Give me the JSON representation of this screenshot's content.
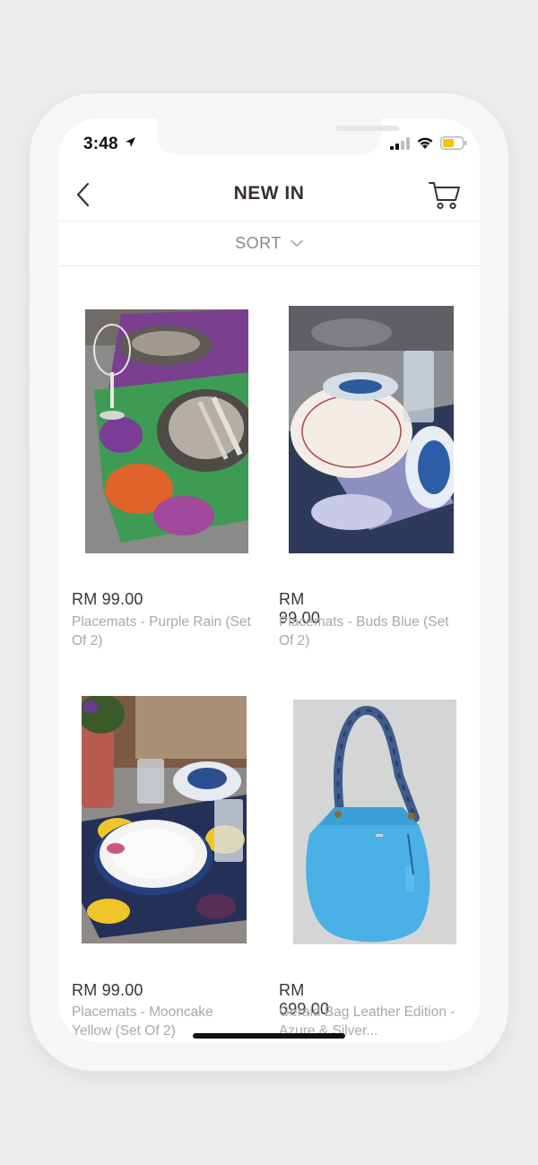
{
  "status_bar": {
    "time": "3:48",
    "location_icon": "location-arrow-icon",
    "signal_icon": "cellular-signal-icon",
    "wifi_icon": "wifi-icon",
    "battery_icon": "battery-low-icon",
    "battery_color": "#f5c400"
  },
  "header": {
    "back_icon": "chevron-left-icon",
    "title": "NEW IN",
    "cart_icon": "shopping-cart-icon"
  },
  "sort": {
    "label": "SORT",
    "icon": "chevron-down-icon"
  },
  "products": [
    {
      "price": "RM 99.00",
      "name": "Placemats - Purple Rain (Set Of 2)"
    },
    {
      "price": "RM 99.00",
      "name": "Placemats - Buds Blue (Set Of 2)"
    },
    {
      "price": "RM 99.00",
      "name": "Placemats - Mooncake Yellow (Set Of 2)"
    },
    {
      "price": "RM 699.00",
      "name": "Gerald Bag Leather Edition - Azure & Silver..."
    }
  ],
  "colors": {
    "title_text": "#3a3030",
    "price_text": "#3c3434",
    "name_text": "#a9a9ad",
    "bag_blue": "#4ab0e6"
  }
}
